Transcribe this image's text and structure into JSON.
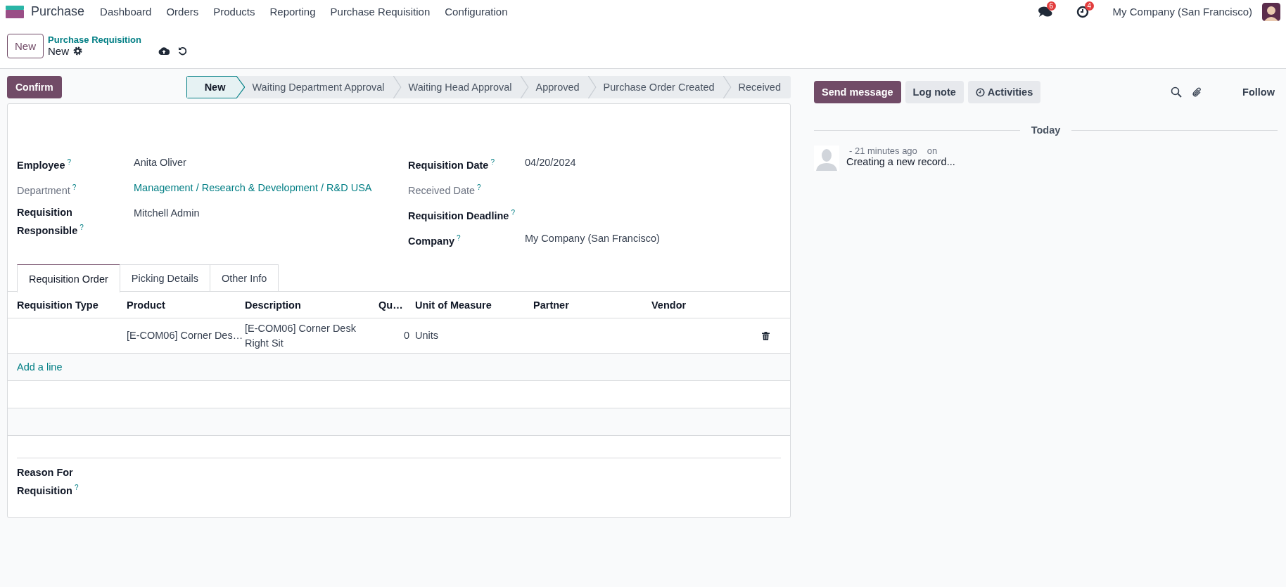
{
  "navbar": {
    "app_name": "Purchase",
    "menu": [
      "Dashboard",
      "Orders",
      "Products",
      "Reporting",
      "Purchase Requisition",
      "Configuration"
    ],
    "messages_count": "6",
    "activities_count": "4",
    "company": "My Company (San Francisco)"
  },
  "control_panel": {
    "new_button": "New",
    "breadcrumb": "Purchase Requisition",
    "record_name": "New"
  },
  "confirm_button": "Confirm",
  "stages": [
    {
      "label": "New",
      "selected": true
    },
    {
      "label": "Waiting Department Approval",
      "selected": false
    },
    {
      "label": "Waiting Head Approval",
      "selected": false
    },
    {
      "label": "Approved",
      "selected": false
    },
    {
      "label": "Purchase Order Created",
      "selected": false
    },
    {
      "label": "Received",
      "selected": false
    }
  ],
  "fields_left": [
    {
      "label": "Employee",
      "required": true,
      "value": "Anita Oliver",
      "kind": "text"
    },
    {
      "label": "Department",
      "required": false,
      "value": "Management / Research & Development / R&D USA",
      "kind": "link"
    },
    {
      "label": "Requisition Responsible",
      "required": true,
      "value": "Mitchell Admin",
      "kind": "text"
    }
  ],
  "fields_right": [
    {
      "label": "Requisition Date",
      "required": true,
      "value": "04/20/2024",
      "kind": "text"
    },
    {
      "label": "Received Date",
      "required": false
    },
    {
      "label": "Requisition Deadline",
      "required": true
    },
    {
      "label": "Company",
      "required": true,
      "value": "My Company (San Francisco)",
      "kind": "text"
    }
  ],
  "help_mark": "?",
  "tabs": [
    {
      "label": "Requisition Order",
      "selected": true
    },
    {
      "label": "Picking Details",
      "selected": false
    },
    {
      "label": "Other Info",
      "selected": false
    }
  ],
  "table": {
    "columns": [
      "Requisition Type",
      "Product",
      "Description",
      "Qu…",
      "Unit of Measure",
      "Partner",
      "Vendor"
    ],
    "rows": [
      {
        "product": "[E-COM06] Corner Des…",
        "description": "[E-COM06] Corner Desk Right Sit",
        "quantity": "0",
        "unit_of_measure": "Units"
      }
    ],
    "add_line": "Add a line"
  },
  "reason_label": "Reason For Requisition",
  "chatter": {
    "buttons": [
      {
        "label": "Send message",
        "kind": "primary"
      },
      {
        "label": "Log note",
        "kind": "secondary"
      },
      {
        "label": "Activities",
        "kind": "activity"
      }
    ],
    "follow": "Follow",
    "date_separator": "Today",
    "message": {
      "time": "- 21 minutes ago",
      "on": "on",
      "body": "Creating a new record..."
    }
  }
}
